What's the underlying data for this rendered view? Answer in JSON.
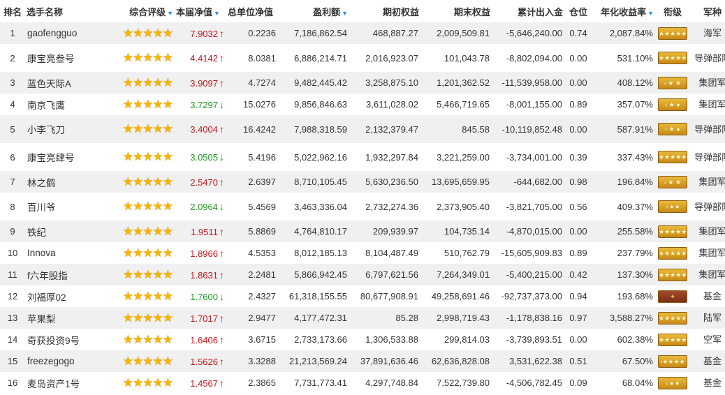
{
  "headers": {
    "rank": "排名",
    "player": "选手名称",
    "rating": "综合评级",
    "cur_nav": "本届净值",
    "total_nav": "总单位净值",
    "profit": "盈利额",
    "begin_equity": "期初权益",
    "end_equity": "期末权益",
    "inout": "累计出入金",
    "position": "仓位",
    "annual": "年化收益率",
    "military_rank": "衔级",
    "branch": "军种"
  },
  "sort_icon": "▼",
  "star_glyph": "★★★★★",
  "colors": {
    "up": "#c8161d",
    "down": "#1a9a1a",
    "star": "#f7b500",
    "sort": "#2a8fd8"
  },
  "rows": [
    {
      "rank": "1",
      "name": "gaofengguo",
      "nav": "7.9032",
      "dir": "up",
      "arrow": "↑",
      "total": "0.2236",
      "profit": "7,186,862.54",
      "begin": "468,887.27",
      "end": "2,009,509.81",
      "inout": "-5,646,240.00",
      "pos": "0.74",
      "annual": "2,087.84%",
      "badge": "★★★★★",
      "badge_style": "gold",
      "branch": "海军",
      "big": false
    },
    {
      "rank": "2",
      "name": "康宝亮叁号",
      "nav": "4.4142",
      "dir": "up",
      "arrow": "↑",
      "total": "8.0381",
      "profit": "6,886,214.71",
      "begin": "2,016,923.07",
      "end": "101,043.78",
      "inout": "-8,802,094.00",
      "pos": "0.00",
      "annual": "531.10%",
      "badge": "★★★★★",
      "badge_style": "gold",
      "branch": "导弹部队",
      "big": true
    },
    {
      "rank": "3",
      "name": "蓝色天际A",
      "nav": "3.9097",
      "dir": "up",
      "arrow": "↑",
      "total": "4.7274",
      "profit": "9,482,445.42",
      "begin": "3,258,875.10",
      "end": "1,201,362.52",
      "inout": "-11,539,958.00",
      "pos": "0.00",
      "annual": "408.12%",
      "badge": "‹ ★ ★",
      "badge_style": "gold",
      "branch": "集团军",
      "big": false
    },
    {
      "rank": "4",
      "name": "南京飞鹰",
      "nav": "3.7297",
      "dir": "down",
      "arrow": "↓",
      "total": "15.0276",
      "profit": "9,856,846.63",
      "begin": "3,611,028.02",
      "end": "5,466,719.65",
      "inout": "-8,001,155.00",
      "pos": "0.89",
      "annual": "357.07%",
      "badge": "‹ ★ ●",
      "badge_style": "gold",
      "branch": "集团军",
      "big": false
    },
    {
      "rank": "5",
      "name": "小李飞刀",
      "nav": "3.4004",
      "dir": "up",
      "arrow": "↑",
      "total": "16.4242",
      "profit": "7,988,318.59",
      "begin": "2,132,379.47",
      "end": "845.58",
      "inout": "-10,119,852.48",
      "pos": "0.00",
      "annual": "587.91%",
      "badge": "‹ ★ ●",
      "badge_style": "gold",
      "branch": "导弹部队",
      "big": true
    },
    {
      "rank": "6",
      "name": "康宝亮肆号",
      "nav": "3.0505",
      "dir": "down",
      "arrow": "↓",
      "total": "5.4196",
      "profit": "5,022,962.16",
      "begin": "1,932,297.84",
      "end": "3,221,259.00",
      "inout": "-3,734,001.00",
      "pos": "0.39",
      "annual": "337.43%",
      "badge": "★★★★★",
      "badge_style": "gold",
      "branch": "导弹部队",
      "big": true
    },
    {
      "rank": "7",
      "name": "林之鹤",
      "nav": "2.5470",
      "dir": "up",
      "arrow": "↑",
      "total": "2.6397",
      "profit": "8,710,105.45",
      "begin": "5,630,236.50",
      "end": "13,695,659.95",
      "inout": "-644,682.00",
      "pos": "0.98",
      "annual": "196.84%",
      "badge": "‹ ★ ★",
      "badge_style": "gold",
      "branch": "集团军",
      "big": false
    },
    {
      "rank": "8",
      "name": "百川爷",
      "nav": "2.0964",
      "dir": "down",
      "arrow": "↓",
      "total": "5.4569",
      "profit": "3,463,336.04",
      "begin": "2,732,274.36",
      "end": "2,373,905.40",
      "inout": "-3,821,705.00",
      "pos": "0.56",
      "annual": "409.37%",
      "badge": "‹ ● ●",
      "badge_style": "gold",
      "branch": "导弹部队",
      "big": true
    },
    {
      "rank": "9",
      "name": "铁纪",
      "nav": "1.9511",
      "dir": "up",
      "arrow": "↑",
      "total": "5.8869",
      "profit": "4,764,810.17",
      "begin": "209,939.97",
      "end": "104,735.14",
      "inout": "-4,870,015.00",
      "pos": "0.00",
      "annual": "255.58%",
      "badge": "★★★★★",
      "badge_style": "gold",
      "branch": "集团军",
      "big": false
    },
    {
      "rank": "10",
      "name": "Innova",
      "nav": "1.8966",
      "dir": "up",
      "arrow": "↑",
      "total": "4.5353",
      "profit": "8,012,185.13",
      "begin": "8,104,487.49",
      "end": "510,762.79",
      "inout": "-15,605,909.83",
      "pos": "0.89",
      "annual": "237.79%",
      "badge": "★★★★★",
      "badge_style": "gold",
      "branch": "集团军",
      "big": false
    },
    {
      "rank": "11",
      "name": "f六年股指",
      "nav": "1.8631",
      "dir": "up",
      "arrow": "↑",
      "total": "2.2481",
      "profit": "5,866,942.45",
      "begin": "6,797,621.56",
      "end": "7,264,349.01",
      "inout": "-5,400,215.00",
      "pos": "0.42",
      "annual": "137.30%",
      "badge": "★★★★★",
      "badge_style": "gold",
      "branch": "集团军",
      "big": false
    },
    {
      "rank": "12",
      "name": "刘福厚02",
      "nav": "1.7600",
      "dir": "down",
      "arrow": "↓",
      "total": "2.4327",
      "profit": "61,318,155.55",
      "begin": "80,677,908.91",
      "end": "49,258,691.46",
      "inout": "-92,737,373.00",
      "pos": "0.94",
      "annual": "193.68%",
      "badge": "✦",
      "badge_style": "red",
      "branch": "基金",
      "big": false
    },
    {
      "rank": "13",
      "name": "苹果梨",
      "nav": "1.7017",
      "dir": "up",
      "arrow": "↑",
      "total": "2.9477",
      "profit": "4,177,472.31",
      "begin": "85.28",
      "end": "2,998,719.43",
      "inout": "-1,178,838.16",
      "pos": "0.97",
      "annual": "3,588.27%",
      "badge": "★★★★★",
      "badge_style": "gold",
      "branch": "陆军",
      "big": false
    },
    {
      "rank": "14",
      "name": "奇获投资9号",
      "nav": "1.6406",
      "dir": "up",
      "arrow": "↑",
      "total": "3.6715",
      "profit": "2,733,173.66",
      "begin": "1,306,533.88",
      "end": "299,814.03",
      "inout": "-3,739,893.51",
      "pos": "0.00",
      "annual": "602.38%",
      "badge": "★★★★★",
      "badge_style": "gold",
      "branch": "空军",
      "big": false
    },
    {
      "rank": "15",
      "name": "freezegogo",
      "nav": "1.5626",
      "dir": "up",
      "arrow": "↑",
      "total": "3.3288",
      "profit": "21,213,569.24",
      "begin": "37,891,636.46",
      "end": "62,636,828.08",
      "inout": "3,531,622.38",
      "pos": "0.51",
      "annual": "67.50%",
      "badge": "‹★★★★",
      "badge_style": "gold",
      "branch": "基金",
      "big": false
    },
    {
      "rank": "16",
      "name": "麦岛资产1号",
      "nav": "1.4567",
      "dir": "up",
      "arrow": "↑",
      "total": "2.3865",
      "profit": "7,731,773.41",
      "begin": "4,297,748.84",
      "end": "7,522,739.80",
      "inout": "-4,506,782.45",
      "pos": "0.09",
      "annual": "68.04%",
      "badge": "‹ ● ●",
      "badge_style": "gold",
      "branch": "基金",
      "big": false
    }
  ]
}
